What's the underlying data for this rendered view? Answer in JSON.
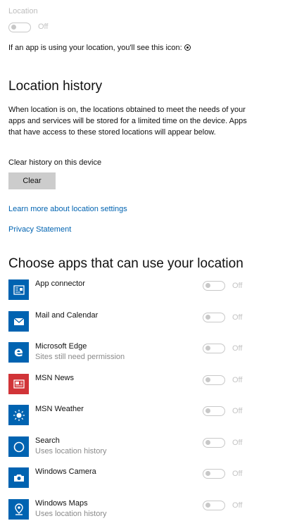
{
  "location": {
    "label": "Location",
    "toggle_state": "Off"
  },
  "icon_note": "If an app is using your location, you'll see this icon:",
  "history": {
    "title": "Location history",
    "description": "When location is on, the locations obtained to meet the needs of your apps and services will be stored for a limited time on the device. Apps that have access to these stored locations will appear below.",
    "clear_label": "Clear history on this device",
    "clear_button": "Clear"
  },
  "links": {
    "learn_more": "Learn more about location settings",
    "privacy": "Privacy Statement"
  },
  "apps_section": {
    "title": "Choose apps that can use your location",
    "apps": [
      {
        "name": "App connector",
        "subtitle": "",
        "icon": "app-connector-icon",
        "color": "#0063b1",
        "state": "Off"
      },
      {
        "name": "Mail and Calendar",
        "subtitle": "",
        "icon": "mail-icon",
        "color": "#0063b1",
        "state": "Off"
      },
      {
        "name": "Microsoft Edge",
        "subtitle": "Sites still need permission",
        "icon": "edge-icon",
        "color": "#0063b1",
        "state": "Off"
      },
      {
        "name": "MSN News",
        "subtitle": "",
        "icon": "news-icon",
        "color": "#d13438",
        "state": "Off"
      },
      {
        "name": "MSN Weather",
        "subtitle": "",
        "icon": "weather-sun-icon",
        "color": "#0063b1",
        "state": "Off"
      },
      {
        "name": "Search",
        "subtitle": "Uses location history",
        "icon": "search-circle-icon",
        "color": "#0063b1",
        "state": "Off"
      },
      {
        "name": "Windows Camera",
        "subtitle": "",
        "icon": "camera-icon",
        "color": "#0063b1",
        "state": "Off"
      },
      {
        "name": "Windows Maps",
        "subtitle": "Uses location history",
        "icon": "maps-icon",
        "color": "#0063b1",
        "state": "Off"
      }
    ]
  },
  "colors": {
    "accent": "#0063b1",
    "news_red": "#d13438",
    "disabled": "#c8c8c8"
  }
}
